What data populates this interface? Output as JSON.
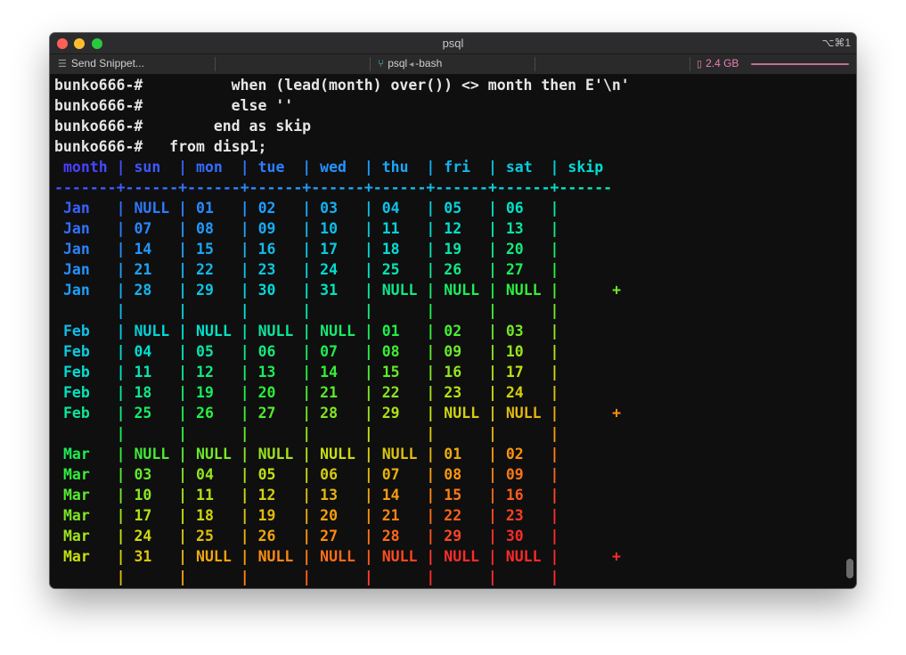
{
  "window": {
    "title": "psql",
    "shortcut": "⌥⌘1"
  },
  "toolbar": {
    "snippet_label": "Send Snippet...",
    "tab_label": "psql",
    "tab_sublabel": "-bash",
    "memory": "2.4 GB",
    "icons": {
      "snippet": "list-icon",
      "tab": "branch-icon",
      "memory": "memory-icon"
    }
  },
  "terminal": {
    "prompt": "bunko666-#",
    "command_lines": [
      "          when (lead(month) over()) <> month then E'\\n'",
      "          else ''",
      "        end as skip",
      "   from disp1;"
    ],
    "header": " month | sun  | mon  | tue  | wed  | thu  | fri  | sat  | skip",
    "separator": "-------+------+------+------+------+------+------+------+------",
    "rows": [
      " Jan   | NULL | 01   | 02   | 03   | 04   | 05   | 06   |",
      " Jan   | 07   | 08   | 09   | 10   | 11   | 12   | 13   |",
      " Jan   | 14   | 15   | 16   | 17   | 18   | 19   | 20   |",
      " Jan   | 21   | 22   | 23   | 24   | 25   | 26   | 27   |",
      " Jan   | 28   | 29   | 30   | 31   | NULL | NULL | NULL |      +",
      "       |      |      |      |      |      |      |      |",
      " Feb   | NULL | NULL | NULL | NULL | 01   | 02   | 03   |",
      " Feb   | 04   | 05   | 06   | 07   | 08   | 09   | 10   |",
      " Feb   | 11   | 12   | 13   | 14   | 15   | 16   | 17   |",
      " Feb   | 18   | 19   | 20   | 21   | 22   | 23   | 24   |",
      " Feb   | 25   | 26   | 27   | 28   | 29   | NULL | NULL |      +",
      "       |      |      |      |      |      |      |      |",
      " Mar   | NULL | NULL | NULL | NULL | NULL | 01   | 02   |",
      " Mar   | 03   | 04   | 05   | 06   | 07   | 08   | 09   |",
      " Mar   | 10   | 11   | 12   | 13   | 14   | 15   | 16   |",
      " Mar   | 17   | 18   | 19   | 20   | 21   | 22   | 23   |",
      " Mar   | 24   | 25   | 26   | 27   | 28   | 29   | 30   |",
      " Mar   | 31   | NULL | NULL | NULL | NULL | NULL | NULL |      +",
      "       |      |      |      |      |      |      |      |"
    ],
    "colors": {
      "prompt": "#e6e6e6",
      "gradient_start": "#4a3cff",
      "gradient_mid": "#00e0d0",
      "gradient_end": "#ff2a2a"
    }
  }
}
